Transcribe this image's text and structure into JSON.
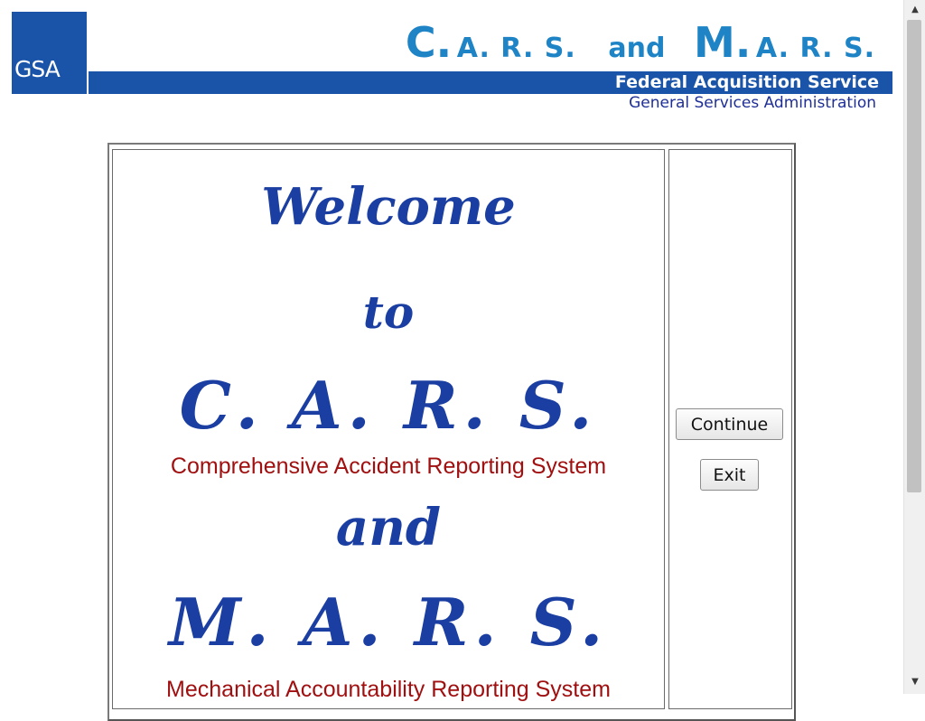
{
  "header": {
    "logo_text": "GSA",
    "title": {
      "c": "C.",
      "cars_rest": "A. R. S.",
      "and": "and",
      "m": "M.",
      "mars_rest": "A. R. S."
    },
    "service_name": "Federal Acquisition Service",
    "agency_name": "General Services Administration"
  },
  "welcome": {
    "welcome": "Welcome",
    "to": "to",
    "cars": "C. A. R. S.",
    "cars_full": "Comprehensive Accident Reporting System",
    "and": "and",
    "mars": "M. A. R. S.",
    "mars_full": "Mechanical Accountability Reporting System"
  },
  "buttons": {
    "continue": "Continue",
    "exit": "Exit"
  },
  "colors": {
    "brand_blue": "#1a54a8",
    "title_blue": "#1e84c6",
    "script_blue": "#1a3ea1",
    "subtitle_red": "#a01010"
  }
}
